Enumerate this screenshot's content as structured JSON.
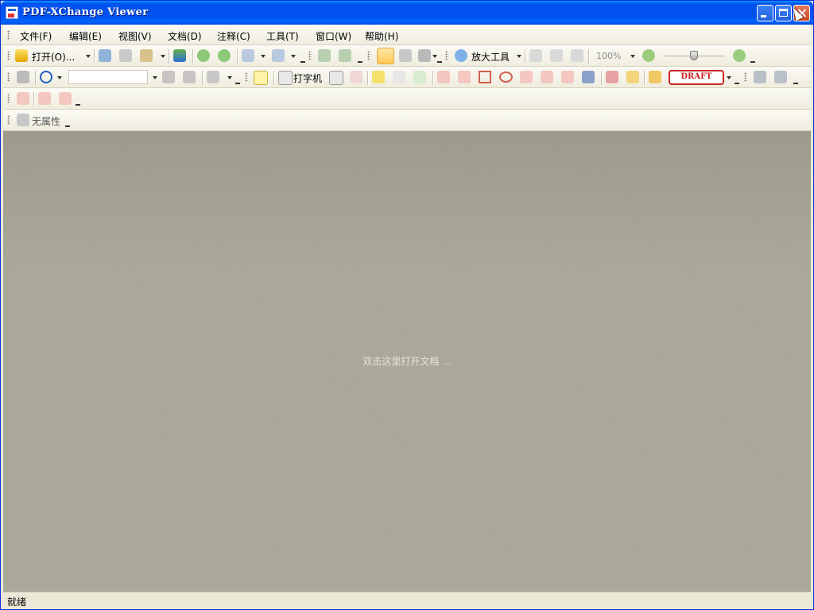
{
  "window": {
    "title": "PDF-XChange Viewer"
  },
  "menu": [
    "文件(F)",
    "编辑(E)",
    "视图(V)",
    "文档(D)",
    "注释(C)",
    "工具(T)",
    "窗口(W)",
    "帮助(H)"
  ],
  "toolbar1": {
    "open_label": "打开(O)...",
    "zoom_tool_label": "放大工具",
    "zoom_value": "100%"
  },
  "toolbar2": {
    "typewriter_label": "打字机",
    "stamp_label": "DRAFT"
  },
  "toolbar4": {
    "properties_label": "无属性"
  },
  "content": {
    "hint": "双击这里打开文档 ..."
  },
  "status": {
    "text": "就绪"
  }
}
